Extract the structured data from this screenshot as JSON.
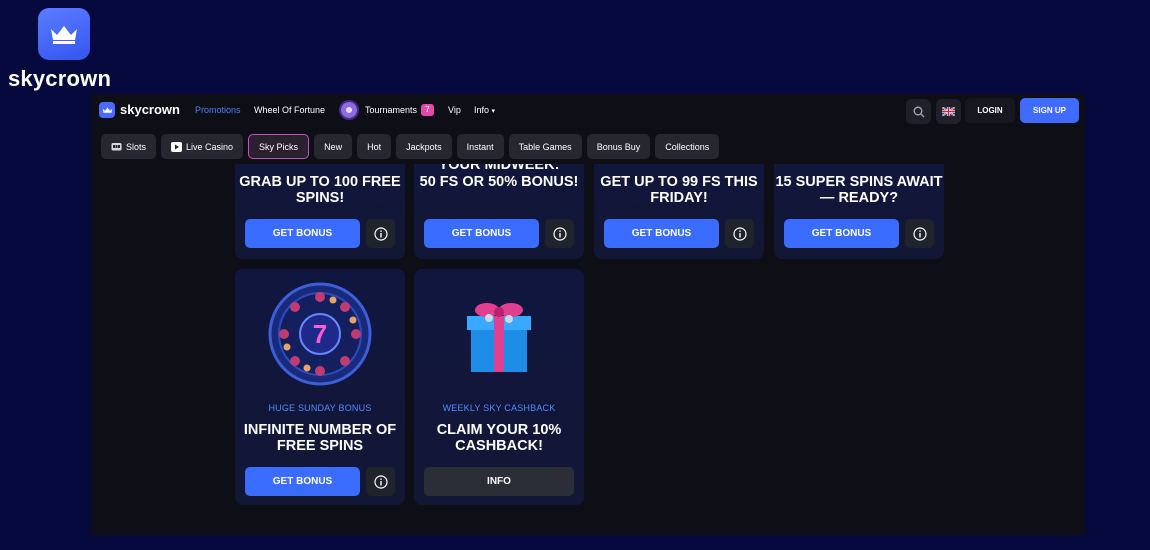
{
  "brand": {
    "name": "skycrown"
  },
  "topbar": {
    "logo_name": "skycrown",
    "nav": [
      {
        "label": "Promotions",
        "active": true
      },
      {
        "label": "Wheel Of Fortune"
      },
      {
        "label": "Tournaments",
        "badge": "7"
      },
      {
        "label": "Vip"
      },
      {
        "label": "Info"
      }
    ],
    "login_label": "LOGIN",
    "signup_label": "SIGN UP"
  },
  "categories": [
    {
      "label": "Slots",
      "icon": "slot-machine-icon"
    },
    {
      "label": "Live Casino",
      "icon": "play-icon"
    },
    {
      "label": "Sky Picks",
      "active": true
    },
    {
      "label": "New"
    },
    {
      "label": "Hot"
    },
    {
      "label": "Jackpots"
    },
    {
      "label": "Instant"
    },
    {
      "label": "Table Games"
    },
    {
      "label": "Bonus Buy"
    },
    {
      "label": "Collections"
    }
  ],
  "promos_row1": [
    {
      "title": "GRAB UP TO 100 FREE SPINS!",
      "button": "GET BONUS"
    },
    {
      "title_top": "YOUR MIDWEEK:",
      "title": "50 FS OR 50% BONUS!",
      "button": "GET BONUS"
    },
    {
      "title": "GET UP TO 99 FS THIS FRIDAY!",
      "button": "GET BONUS"
    },
    {
      "title": "15 SUPER SPINS AWAIT — READY?",
      "button": "GET BONUS"
    }
  ],
  "promos_row2": [
    {
      "subtitle": "HUGE SUNDAY BONUS",
      "title": "INFINITE NUMBER OF FREE SPINS",
      "button": "GET BONUS",
      "art": "wheel-seven-icon",
      "art_text": "7"
    },
    {
      "subtitle": "WEEKLY SKY CASHBACK",
      "title": "CLAIM YOUR 10% CASHBACK!",
      "button": "INFO",
      "art": "gift-box-icon"
    }
  ],
  "colors": {
    "accent": "#3f6bff",
    "page_bg": "#05093d",
    "app_bg": "#0d0e16",
    "active_tab_border": "#c94ec7",
    "subtitle": "#4f8bff"
  }
}
